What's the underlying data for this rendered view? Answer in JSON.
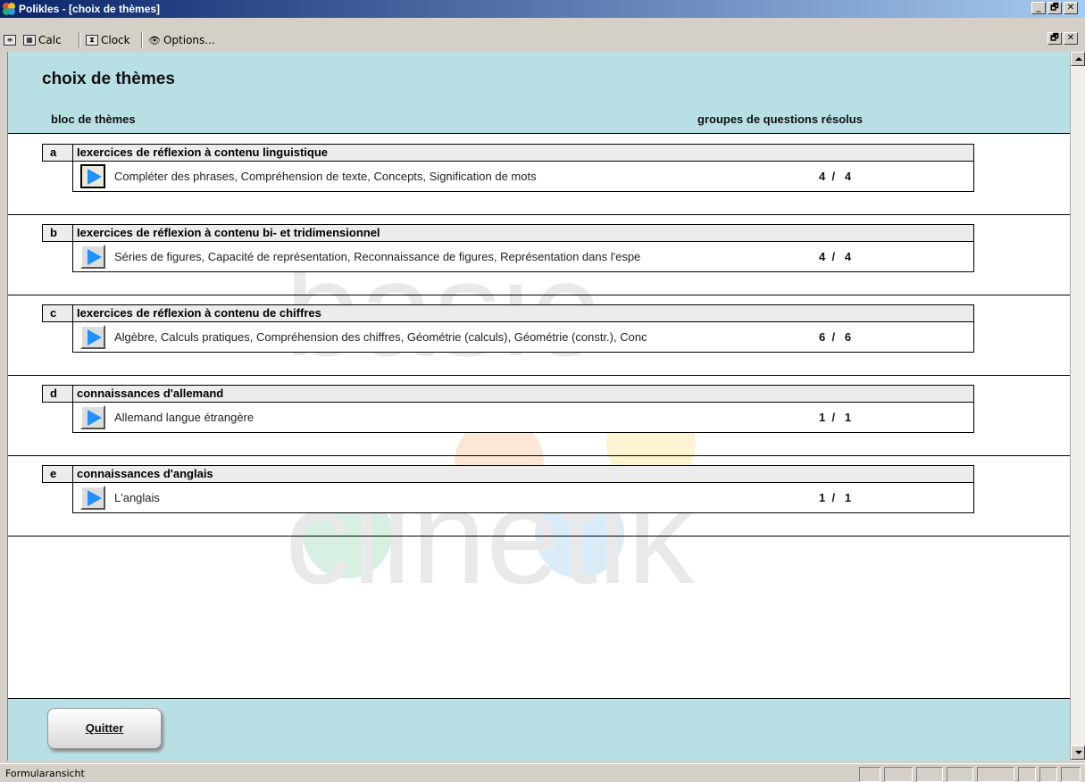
{
  "window": {
    "title": "Polikles - [choix de thèmes]",
    "buttons": [
      "_",
      "🗗",
      "✕"
    ]
  },
  "toolbar": {
    "items": [
      {
        "label": "Calc",
        "icon": "calculator-icon"
      },
      {
        "label": "Clock",
        "icon": "clock-icon"
      },
      {
        "label": "Options...",
        "icon": "options-icon"
      }
    ],
    "mdi_buttons": [
      "🗗",
      "✕"
    ]
  },
  "form": {
    "title": "choix de thèmes",
    "col_left": "bloc de thèmes",
    "col_right": "groupes de questions résolus",
    "sections": [
      {
        "letter": "a",
        "title": "Iexercices de réflexion à contenu linguistique",
        "text": "Compléter des phrases, Compréhension de texte, Concepts, Signification de mots",
        "solved": "4",
        "total": "4"
      },
      {
        "letter": "b",
        "title": "Iexercices de réflexion à contenu bi- et tridimensionnel",
        "text": "Séries de figures, Capacité de représentation, Reconnaissance de figures, Représentation dans l'espe",
        "solved": "4",
        "total": "4"
      },
      {
        "letter": "c",
        "title": "Iexercices de réflexion à contenu de chiffres",
        "text": "Algèbre, Calculs pratiques, Compréhension des chiffres, Géométrie (calculs), Géométrie (constr.), Conc",
        "solved": "6",
        "total": "6"
      },
      {
        "letter": "d",
        "title": "connaissances d'allemand",
        "text": "Allemand langue étrangère",
        "solved": "1",
        "total": "1"
      },
      {
        "letter": "e",
        "title": "connaissances d'anglais",
        "text": "L'anglais",
        "solved": "1",
        "total": "1"
      }
    ],
    "quit_label": "Quitter"
  },
  "status": {
    "text": "Formularansicht"
  },
  "colors": {
    "header_bg": "#b8dfe3",
    "accent_play": "#1e90ff",
    "titlebar": "#0a246a"
  }
}
